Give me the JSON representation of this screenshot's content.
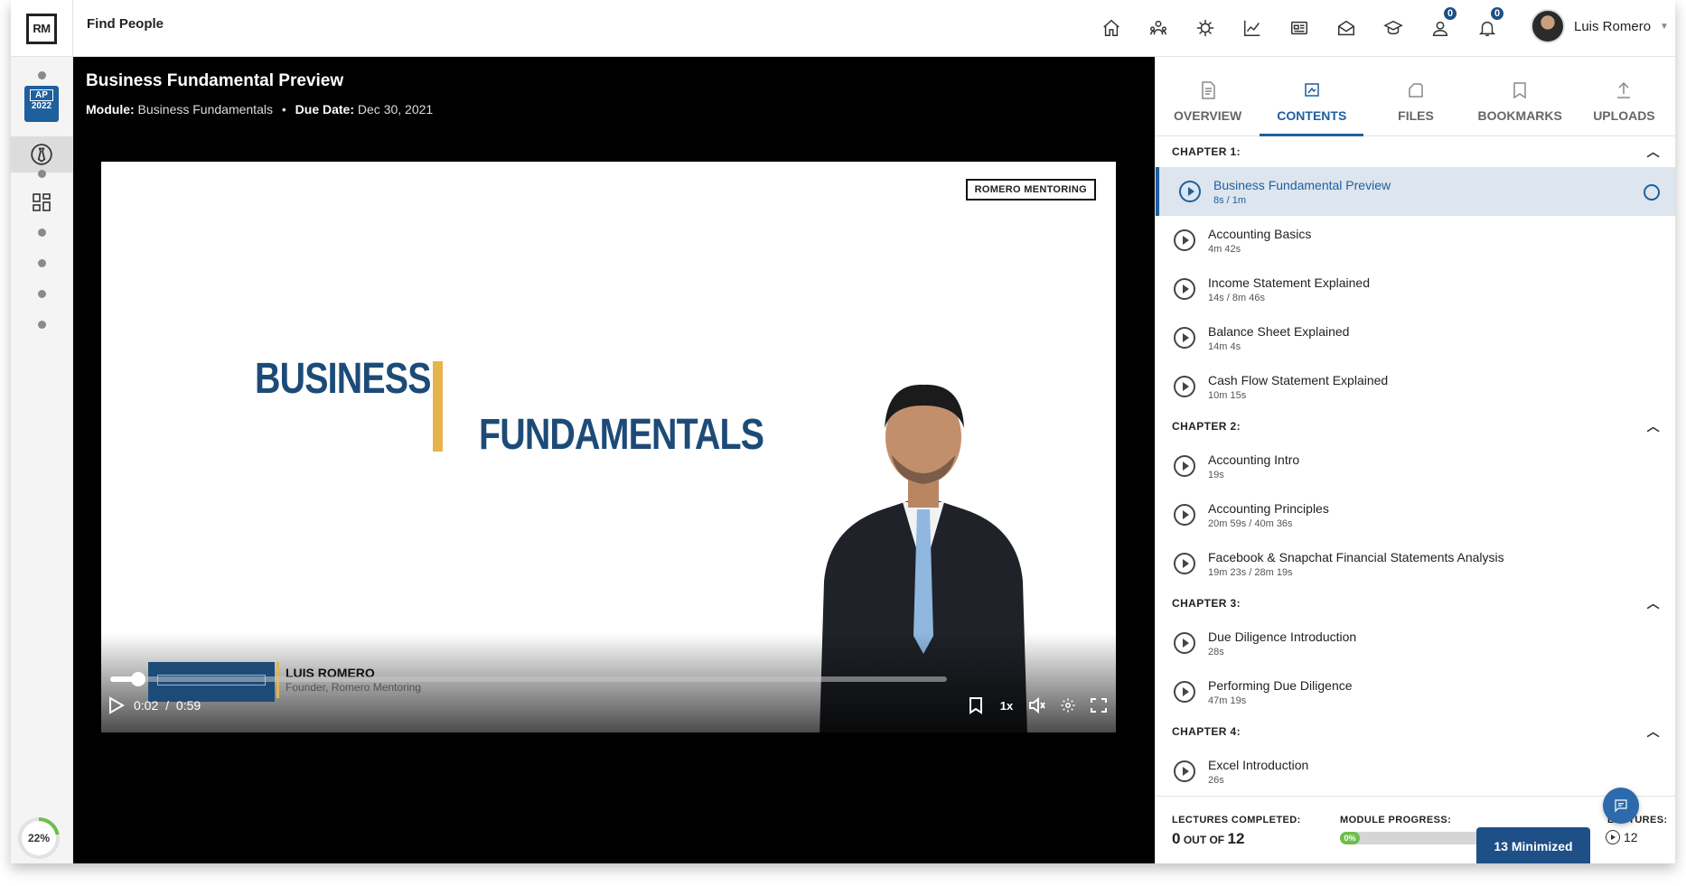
{
  "app": {
    "logo": "RM",
    "find_people": "Find People"
  },
  "nav": {
    "icons": [
      "home-icon",
      "people-network-icon",
      "virus-icon",
      "line-chart-icon",
      "news-icon",
      "mail-icon",
      "graduation-icon",
      "contacts-icon",
      "bell-icon"
    ],
    "contacts_badge": "0",
    "notifications_badge": "0",
    "user_name": "Luis Romero"
  },
  "rail": {
    "badge_top": "AP",
    "badge_bottom": "2022",
    "progress": "22%",
    "progress_value": 0.22
  },
  "player": {
    "title": "Business Fundamental Preview",
    "module_label": "Module:",
    "module_value": "Business Fundamentals",
    "separator": "•",
    "due_label": "Due Date:",
    "due_value": "Dec 30, 2021",
    "brand": "ROMERO MENTORING",
    "slide_word1": "BUSINESS",
    "slide_word2": "FUNDAMENTALS",
    "lower_third_name": "LUIS ROMERO",
    "lower_third_sub": "Founder, Romero Mentoring",
    "time_current": "0:02",
    "time_separator": "/",
    "time_total": "0:59",
    "progress_fraction": 0.034,
    "speed": "1x"
  },
  "tabs": [
    {
      "label": "OVERVIEW",
      "icon": "document-icon"
    },
    {
      "label": "CONTENTS",
      "icon": "contents-icon"
    },
    {
      "label": "FILES",
      "icon": "folder-icon"
    },
    {
      "label": "BOOKMARKS",
      "icon": "bookmark-icon"
    },
    {
      "label": "UPLOADS",
      "icon": "upload-icon"
    }
  ],
  "chapters": [
    {
      "title": "CHAPTER 1:",
      "lectures": [
        {
          "title": "Business Fundamental Preview",
          "duration": "8s / 1m"
        },
        {
          "title": "Accounting Basics",
          "duration": "4m 42s"
        },
        {
          "title": "Income Statement Explained",
          "duration": "14s / 8m 46s"
        },
        {
          "title": "Balance Sheet Explained",
          "duration": "14m 4s"
        },
        {
          "title": "Cash Flow Statement Explained",
          "duration": "10m 15s"
        }
      ]
    },
    {
      "title": "CHAPTER 2:",
      "lectures": [
        {
          "title": "Accounting Intro",
          "duration": "19s"
        },
        {
          "title": "Accounting Principles",
          "duration": "20m 59s / 40m 36s"
        },
        {
          "title": "Facebook & Snapchat Financial Statements Analysis",
          "duration": "19m 23s / 28m 19s"
        }
      ]
    },
    {
      "title": "CHAPTER 3:",
      "lectures": [
        {
          "title": "Due Diligence Introduction",
          "duration": "28s"
        },
        {
          "title": "Performing Due Diligence",
          "duration": "47m 19s"
        }
      ]
    },
    {
      "title": "CHAPTER 4:",
      "lectures": [
        {
          "title": "Excel Introduction",
          "duration": "26s"
        }
      ]
    }
  ],
  "footer": {
    "completed_label": "LECTURES COMPLETED:",
    "completed_count": "0",
    "completed_of": "OUT OF",
    "completed_total": "12",
    "module_progress_label": "MODULE PROGRESS:",
    "module_progress_value": "0%",
    "lectures_label": "LECTURES:",
    "lectures_count": "12",
    "minimized": "13 Minimized"
  },
  "colors": {
    "accent": "#1e5f9e",
    "navy": "#1e4f86",
    "gold": "#e5b44d",
    "green": "#6cbf4a"
  }
}
